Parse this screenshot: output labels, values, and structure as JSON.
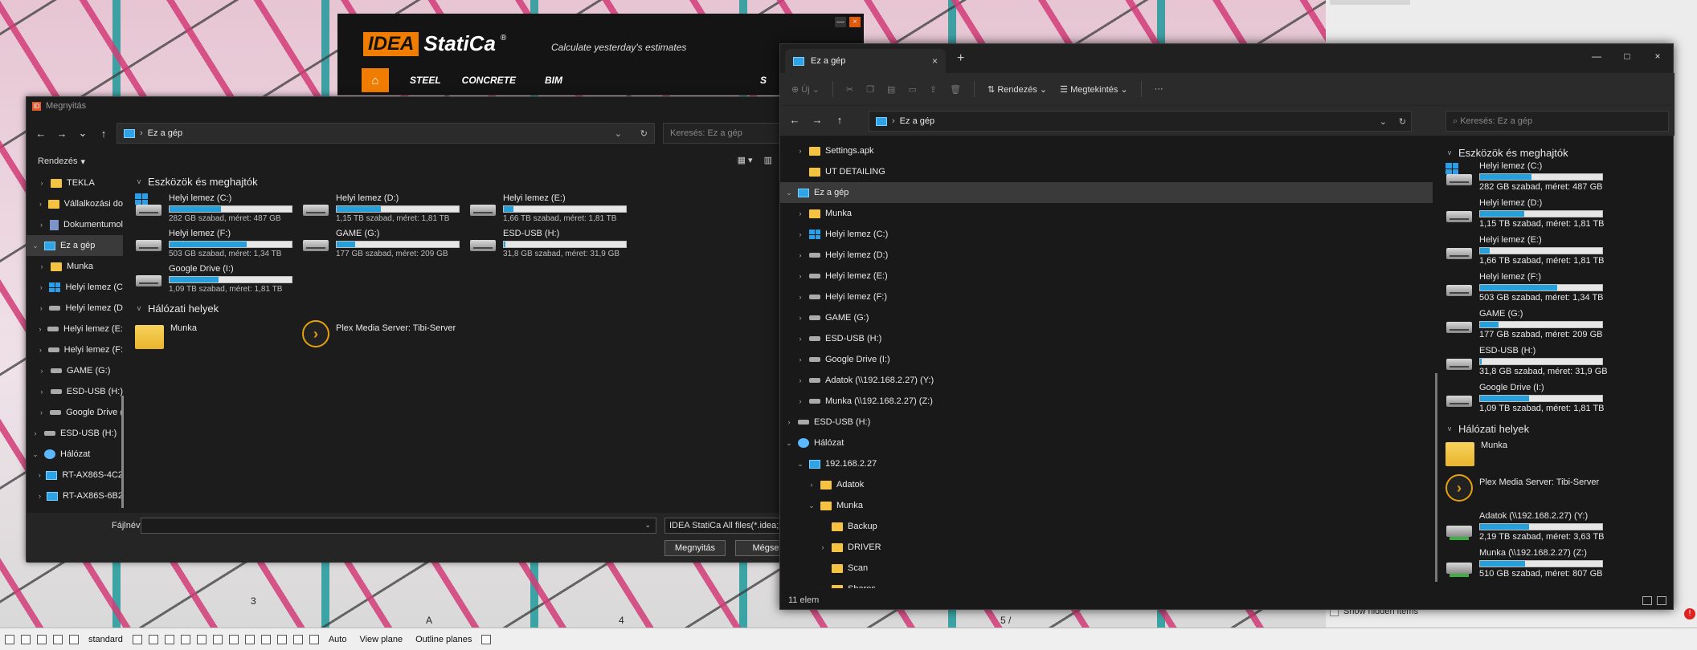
{
  "desktop": {
    "numbers": [
      "3",
      "A",
      "4",
      "5 /"
    ],
    "show_hidden_label": "Show hidden items",
    "error_glyph": "!"
  },
  "bottom_toolbar": {
    "preset": "standard",
    "auto": "Auto",
    "view_plane": "View plane",
    "outline_planes": "Outline planes"
  },
  "idea": {
    "logo_box": "IDEA",
    "logo_text": "StatiCa",
    "registered": "®",
    "tagline": "Calculate yesterday's estimates",
    "nav": [
      "STEEL",
      "CONCRETE",
      "BIM",
      "S"
    ],
    "home_glyph": "⌂",
    "wc_min": "—",
    "wc_max": "□",
    "wc_close": "×"
  },
  "dialog": {
    "title": "Megnyitás",
    "app_icon": "ID",
    "address": "Ez a gép",
    "search_placeholder": "Keresés: Ez a gép",
    "organize_label": "Rendezés",
    "tree": [
      {
        "label": "TEKLA",
        "icon": "folder",
        "arrow": ">",
        "indent": 1
      },
      {
        "label": "Vállalkozási do",
        "icon": "folder",
        "arrow": ">",
        "indent": 1
      },
      {
        "label": "Dokumentumol",
        "icon": "doc",
        "arrow": ">",
        "indent": 1
      },
      {
        "label": "Ez a gép",
        "icon": "pc",
        "arrow": "v",
        "indent": 0,
        "selected": true
      },
      {
        "label": "Munka",
        "icon": "folder",
        "arrow": ">",
        "indent": 1
      },
      {
        "label": "Helyi lemez (C",
        "icon": "win",
        "arrow": ">",
        "indent": 1
      },
      {
        "label": "Helyi lemez (D",
        "icon": "drive",
        "arrow": ">",
        "indent": 1
      },
      {
        "label": "Helyi lemez (E:",
        "icon": "drive",
        "arrow": ">",
        "indent": 1
      },
      {
        "label": "Helyi lemez (F:",
        "icon": "drive",
        "arrow": ">",
        "indent": 1
      },
      {
        "label": "GAME (G:)",
        "icon": "drive",
        "arrow": ">",
        "indent": 1
      },
      {
        "label": "ESD-USB (H:)",
        "icon": "drive",
        "arrow": ">",
        "indent": 1
      },
      {
        "label": "Google Drive (",
        "icon": "drive",
        "arrow": ">",
        "indent": 1
      },
      {
        "label": "ESD-USB (H:)",
        "icon": "drive",
        "arrow": ">",
        "indent": 0
      },
      {
        "label": "Hálózat",
        "icon": "net",
        "arrow": "v",
        "indent": 0
      },
      {
        "label": "RT-AX86S-4C2",
        "icon": "pc",
        "arrow": ">",
        "indent": 1
      },
      {
        "label": "RT-AX86S-6B2",
        "icon": "pc",
        "arrow": ">",
        "indent": 1
      }
    ],
    "devices_heading": "Eszközök és meghajtók",
    "drives": [
      {
        "name": "Helyi lemez (C:)",
        "size": "282 GB szabad, méret: 487 GB",
        "used": 0.42,
        "icon": "win"
      },
      {
        "name": "Helyi lemez (D:)",
        "size": "1,15 TB szabad, méret: 1,81 TB",
        "used": 0.36,
        "icon": "hdd"
      },
      {
        "name": "Helyi lemez (E:)",
        "size": "1,66 TB szabad, méret: 1,81 TB",
        "used": 0.08,
        "icon": "hdd"
      },
      {
        "name": "Helyi lemez (F:)",
        "size": "503 GB szabad, méret: 1,34 TB",
        "used": 0.63,
        "icon": "hdd"
      },
      {
        "name": "GAME (G:)",
        "size": "177 GB szabad, méret: 209 GB",
        "used": 0.15,
        "icon": "hdd"
      },
      {
        "name": "ESD-USB (H:)",
        "size": "31,8 GB szabad, méret: 31,9 GB",
        "used": 0.01,
        "icon": "hdd"
      },
      {
        "name": "Google Drive (I:)",
        "size": "1,09 TB szabad, méret: 1,81 TB",
        "used": 0.4,
        "icon": "hdd"
      }
    ],
    "network_heading": "Hálózati helyek",
    "network": [
      {
        "name": "Munka",
        "icon": "folder"
      },
      {
        "name": "Plex Media Server: Tibi-Server",
        "icon": "plex"
      }
    ],
    "filename_label": "Fájlnév:",
    "filter_label": "IDEA StatiCa All files(*.idea;*.ide",
    "open_button": "Megnyitás",
    "cancel_button": "Mégse"
  },
  "explorer": {
    "tab_title": "Ez a gép",
    "tab_close": "×",
    "new_tab": "+",
    "min": "—",
    "max": "□",
    "close": "×",
    "new_label": "Új",
    "sort_label": "Rendezés",
    "view_label": "Megtekintés",
    "more": "···",
    "address": "Ez a gép",
    "search_placeholder": "Keresés: Ez a gép",
    "tree": [
      {
        "label": "Settings.apk",
        "icon": "folder",
        "arrow": ">",
        "indent": 1
      },
      {
        "label": "UT DETAILING",
        "icon": "folder",
        "arrow": "",
        "indent": 1
      },
      {
        "label": "Ez a gép",
        "icon": "pc",
        "arrow": "v",
        "indent": 0,
        "selected": true
      },
      {
        "label": "Munka",
        "icon": "folder",
        "arrow": ">",
        "indent": 1
      },
      {
        "label": "Helyi lemez (C:)",
        "icon": "win",
        "arrow": ">",
        "indent": 1
      },
      {
        "label": "Helyi lemez (D:)",
        "icon": "drive",
        "arrow": ">",
        "indent": 1
      },
      {
        "label": "Helyi lemez (E:)",
        "icon": "drive",
        "arrow": ">",
        "indent": 1
      },
      {
        "label": "Helyi lemez (F:)",
        "icon": "drive",
        "arrow": ">",
        "indent": 1
      },
      {
        "label": "GAME (G:)",
        "icon": "drive",
        "arrow": ">",
        "indent": 1
      },
      {
        "label": "ESD-USB (H:)",
        "icon": "drive",
        "arrow": ">",
        "indent": 1
      },
      {
        "label": "Google Drive (I:)",
        "icon": "drive",
        "arrow": ">",
        "indent": 1
      },
      {
        "label": "Adatok (\\\\192.168.2.27) (Y:)",
        "icon": "drive",
        "arrow": ">",
        "indent": 1
      },
      {
        "label": "Munka (\\\\192.168.2.27) (Z:)",
        "icon": "drive",
        "arrow": ">",
        "indent": 1
      },
      {
        "label": "ESD-USB (H:)",
        "icon": "drive",
        "arrow": ">",
        "indent": 0
      },
      {
        "label": "Hálózat",
        "icon": "net",
        "arrow": "v",
        "indent": 0
      },
      {
        "label": "192.168.2.27",
        "icon": "pc",
        "arrow": "v",
        "indent": 1
      },
      {
        "label": "Adatok",
        "icon": "folder",
        "arrow": ">",
        "indent": 2
      },
      {
        "label": "Munka",
        "icon": "folder",
        "arrow": "v",
        "indent": 2
      },
      {
        "label": "Backup",
        "icon": "folder",
        "arrow": "",
        "indent": 3
      },
      {
        "label": "DRIVER",
        "icon": "folder",
        "arrow": ">",
        "indent": 3
      },
      {
        "label": "Scan",
        "icon": "folder",
        "arrow": "",
        "indent": 3
      },
      {
        "label": "Shares",
        "icon": "folder",
        "arrow": ">",
        "indent": 3
      }
    ],
    "devices_heading": "Eszközök és meghajtók",
    "drives": [
      {
        "name": "Helyi lemez (C:)",
        "size": "282 GB szabad, méret: 487 GB",
        "used": 0.42,
        "icon": "win"
      },
      {
        "name": "Helyi lemez (D:)",
        "size": "1,15 TB szabad, méret: 1,81 TB",
        "used": 0.36,
        "icon": "hdd"
      },
      {
        "name": "Helyi lemez (E:)",
        "size": "1,66 TB szabad, méret: 1,81 TB",
        "used": 0.08,
        "icon": "hdd"
      },
      {
        "name": "Helyi lemez (F:)",
        "size": "503 GB szabad, méret: 1,34 TB",
        "used": 0.63,
        "icon": "hdd"
      },
      {
        "name": "GAME (G:)",
        "size": "177 GB szabad, méret: 209 GB",
        "used": 0.15,
        "icon": "hdd"
      },
      {
        "name": "ESD-USB (H:)",
        "size": "31,8 GB szabad, méret: 31,9 GB",
        "used": 0.01,
        "icon": "hdd"
      },
      {
        "name": "Google Drive (I:)",
        "size": "1,09 TB szabad, méret: 1,81 TB",
        "used": 0.4,
        "icon": "hdd"
      }
    ],
    "network_heading": "Hálózati helyek",
    "network": [
      {
        "name": "Munka",
        "icon": "folder"
      },
      {
        "name": "Plex Media Server: Tibi-Server",
        "icon": "plex"
      },
      {
        "name": "Adatok (\\\\192.168.2.27) (Y:)",
        "size": "2,19 TB szabad, méret: 3,63 TB",
        "used": 0.4,
        "icon": "netdrv"
      },
      {
        "name": "Munka (\\\\192.168.2.27) (Z:)",
        "size": "510 GB szabad, méret: 807 GB",
        "used": 0.37,
        "icon": "netdrv"
      }
    ],
    "status": "11 elem"
  },
  "colors": {
    "accent": "#26a0da",
    "idea_orange": "#f07d00"
  }
}
